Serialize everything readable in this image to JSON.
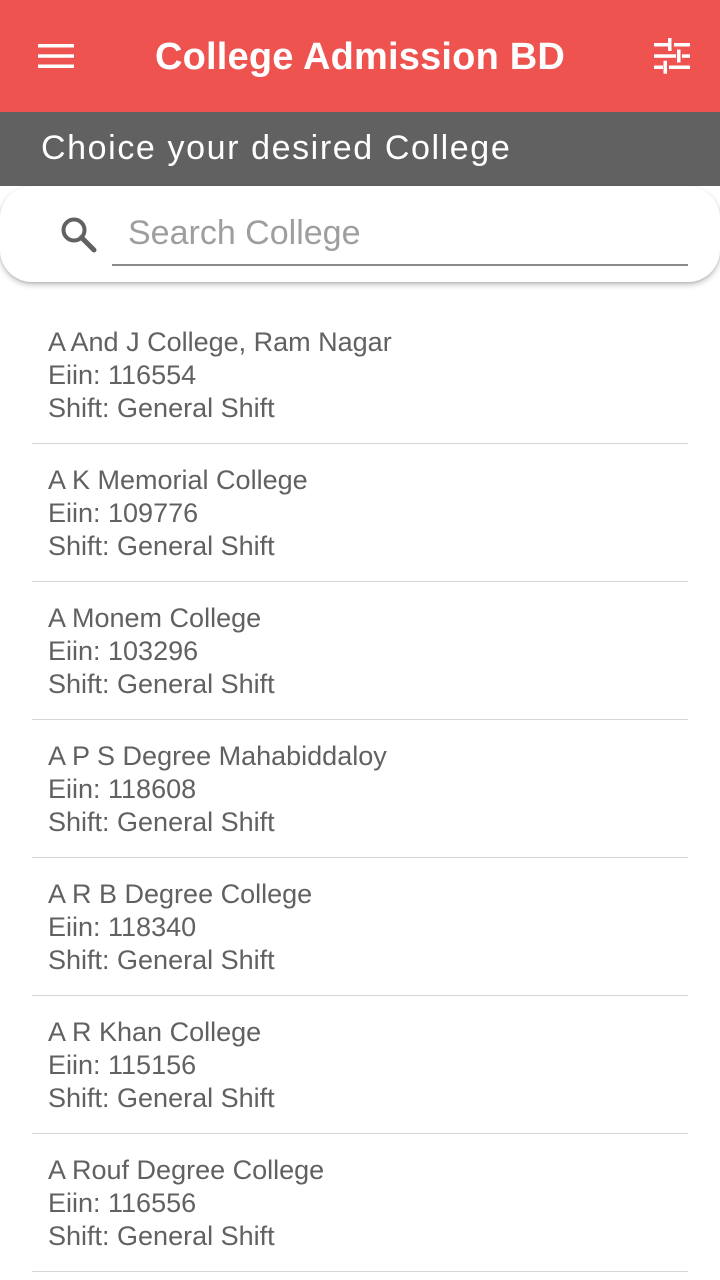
{
  "appbar": {
    "title": "College Admission BD",
    "menu_icon": "hamburger-menu-icon",
    "filter_icon": "tune-sliders-icon",
    "background": "#ee5350"
  },
  "subheader": {
    "text": "Choice your desired College",
    "background": "#616161"
  },
  "search": {
    "placeholder": "Search College",
    "value": "",
    "icon": "search-icon"
  },
  "colleges": [
    {
      "name": "A And J College, Ram Nagar",
      "eiin": "Eiin: 116554",
      "shift": "Shift: General Shift"
    },
    {
      "name": "A K Memorial College",
      "eiin": "Eiin: 109776",
      "shift": "Shift: General Shift"
    },
    {
      "name": "A Monem College",
      "eiin": "Eiin: 103296",
      "shift": "Shift: General Shift"
    },
    {
      "name": "A P S Degree Mahabiddaloy",
      "eiin": "Eiin: 118608",
      "shift": "Shift: General Shift"
    },
    {
      "name": "A R B Degree College",
      "eiin": "Eiin: 118340",
      "shift": "Shift: General Shift"
    },
    {
      "name": "A R Khan College",
      "eiin": "Eiin: 115156",
      "shift": "Shift: General Shift"
    },
    {
      "name": "A Rouf Degree College",
      "eiin": "Eiin: 116556",
      "shift": "Shift: General Shift"
    }
  ]
}
